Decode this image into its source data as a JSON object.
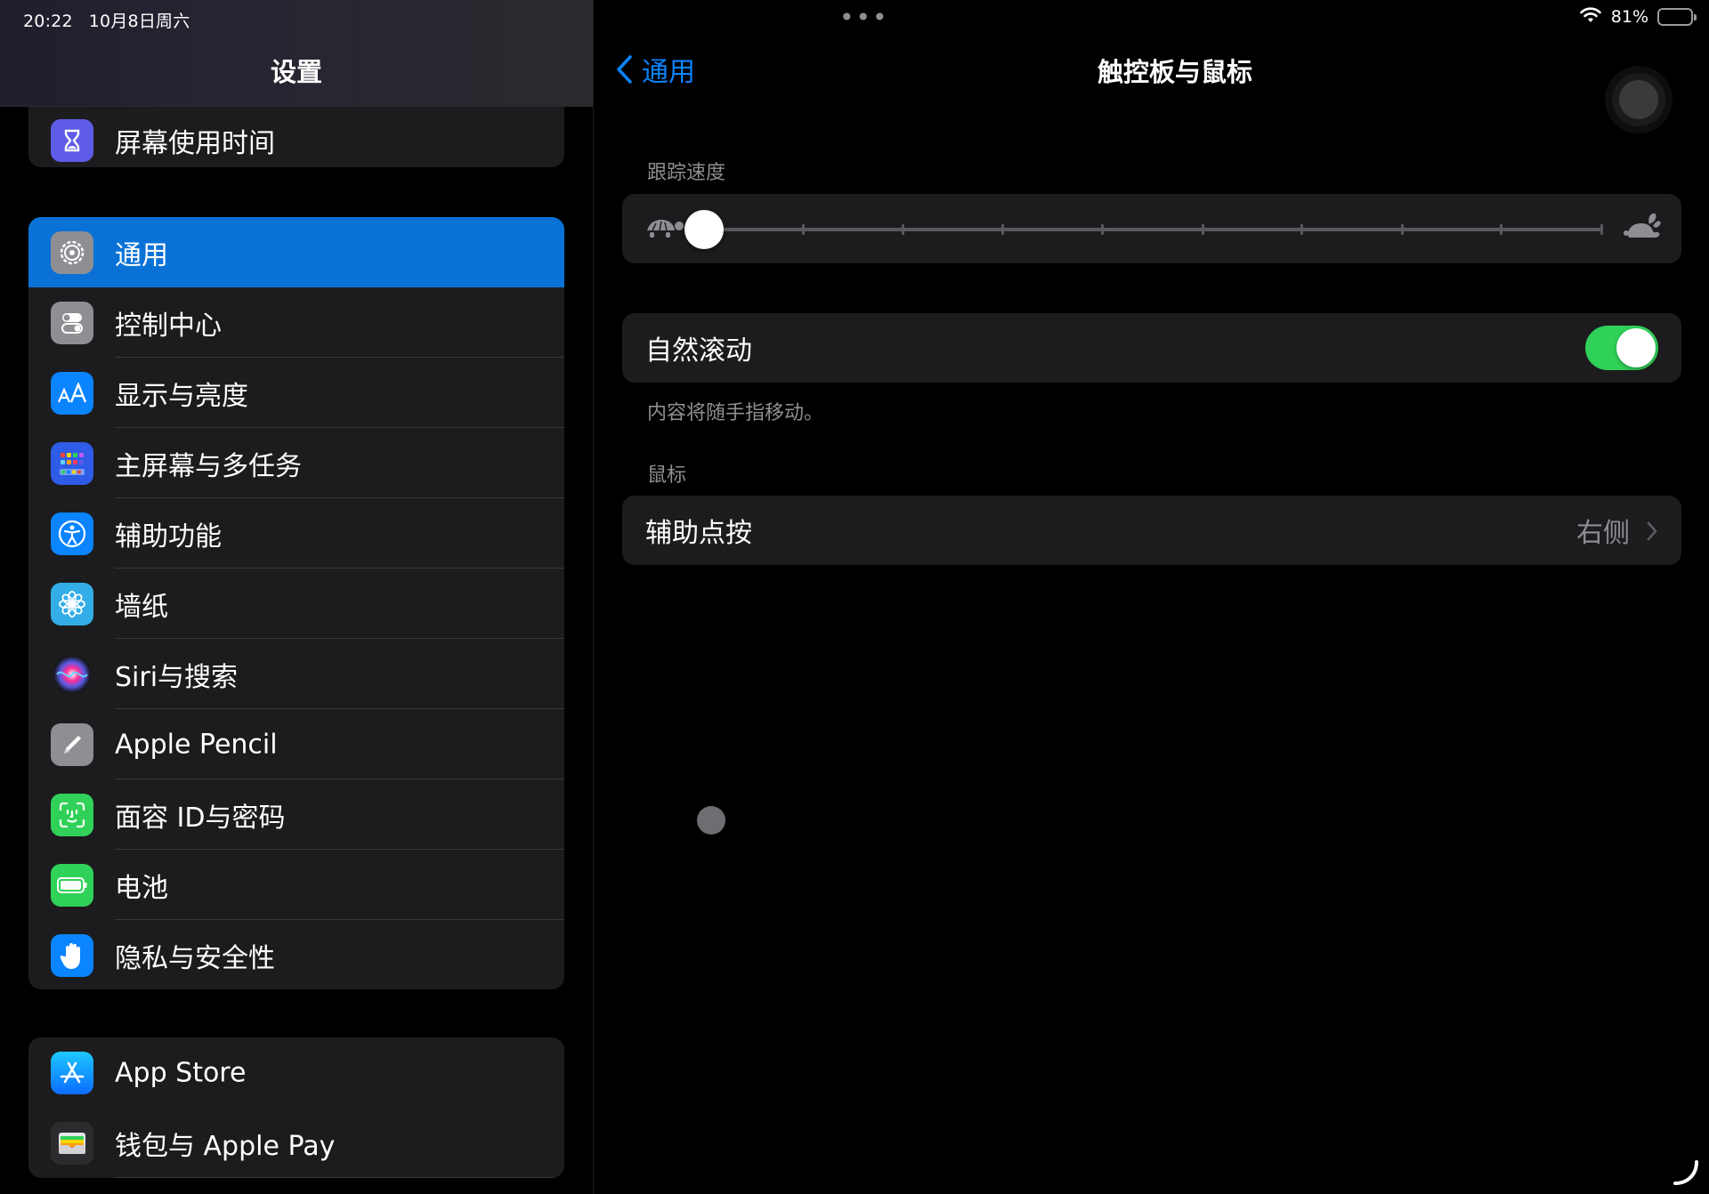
{
  "status": {
    "time": "20:22",
    "date": "10月8日周六",
    "battery": "81%",
    "battery_level": 0.81
  },
  "sidebar": {
    "title": "设置",
    "top_items": [
      {
        "label": "屏幕使用时间",
        "icon": "hourglass-icon",
        "color": "#5e5ce6"
      }
    ],
    "main_items": [
      {
        "label": "通用",
        "icon": "gear-icon",
        "color": "#8e8e93",
        "selected": true
      },
      {
        "label": "控制中心",
        "icon": "toggles-icon",
        "color": "#8e8e93"
      },
      {
        "label": "显示与亮度",
        "icon": "text-size-icon",
        "color": "#0a84ff"
      },
      {
        "label": "主屏幕与多任务",
        "icon": "home-grid-icon",
        "color": "#2f5ce6"
      },
      {
        "label": "辅助功能",
        "icon": "accessibility-icon",
        "color": "#0a84ff"
      },
      {
        "label": "墙纸",
        "icon": "flower-icon",
        "color": "#32ade6"
      },
      {
        "label": "Siri与搜索",
        "icon": "siri-icon",
        "color": "#1c1c1e"
      },
      {
        "label": "Apple Pencil",
        "icon": "pencil-icon",
        "color": "#8e8e93"
      },
      {
        "label": "面容 ID与密码",
        "icon": "face-id-icon",
        "color": "#30d158"
      },
      {
        "label": "电池",
        "icon": "battery-icon",
        "color": "#30d158"
      },
      {
        "label": "隐私与安全性",
        "icon": "hand-icon",
        "color": "#0a84ff"
      }
    ],
    "bottom_items": [
      {
        "label": "App Store",
        "icon": "app-store-icon",
        "color": "#0a84ff"
      },
      {
        "label": "钱包与 Apple Pay",
        "icon": "wallet-icon",
        "color": "#2c2c2e"
      }
    ]
  },
  "detail": {
    "back_label": "通用",
    "title": "触控板与鼠标",
    "tracking_header": "跟踪速度",
    "tracking_speed_level": 0,
    "tracking_steps": 9,
    "natural_scroll_label": "自然滚动",
    "natural_scroll_on": true,
    "natural_scroll_note": "内容将随手指移动。",
    "mouse_header": "鼠标",
    "secondary_click_label": "辅助点按",
    "secondary_click_value": "右侧"
  },
  "colors": {
    "accent": "#0a84ff",
    "selected_row": "#0a72d6",
    "toggle_on": "#30d158",
    "cell_bg": "#1c1c1e",
    "secondary_text": "#8e8e93"
  }
}
